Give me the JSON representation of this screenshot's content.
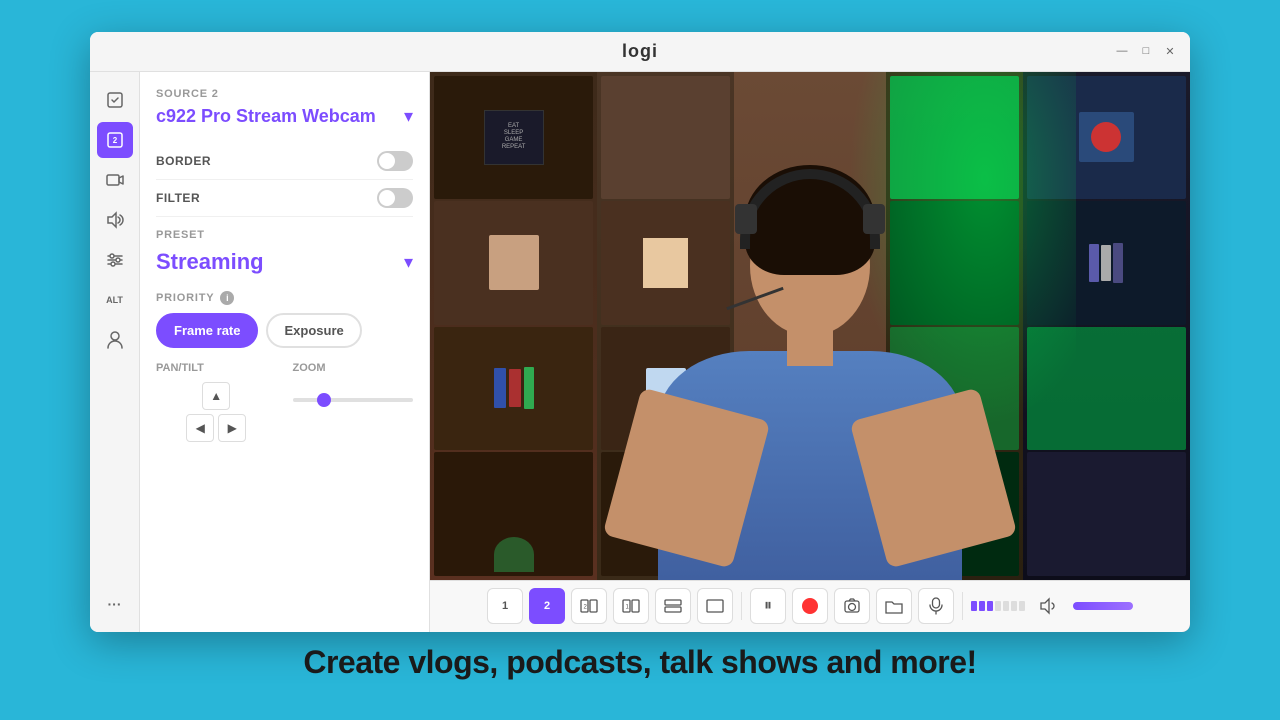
{
  "app": {
    "title": "logi",
    "window_controls": {
      "minimize": "—",
      "maximize": "□",
      "close": "✕"
    }
  },
  "sidebar": {
    "icons": [
      {
        "id": "source1",
        "symbol": "⊡",
        "active": false
      },
      {
        "id": "source2",
        "symbol": "⊡",
        "active": true
      },
      {
        "id": "camera",
        "symbol": "▭",
        "active": false
      },
      {
        "id": "audio",
        "symbol": "◁◁",
        "active": false
      },
      {
        "id": "sliders",
        "symbol": "⊞",
        "active": false
      },
      {
        "id": "alt",
        "symbol": "ALT",
        "active": false
      },
      {
        "id": "person",
        "symbol": "◯",
        "active": false
      },
      {
        "id": "more",
        "symbol": "···",
        "active": false
      }
    ]
  },
  "settings": {
    "source_label": "SOURCE 2",
    "device_name": "c922 Pro Stream Webcam",
    "border_label": "BORDER",
    "filter_label": "FILTER",
    "preset_label": "PRESET",
    "preset_value": "Streaming",
    "priority_label": "PRIORITY",
    "priority_frame_rate": "Frame rate",
    "priority_exposure": "Exposure",
    "pan_tilt_label": "PAN/TILT",
    "zoom_label": "ZOOM"
  },
  "toolbar": {
    "buttons": [
      {
        "id": "t1",
        "label": "1",
        "active": false
      },
      {
        "id": "t2",
        "label": "2",
        "active": true
      },
      {
        "id": "t3",
        "label": "⊡2",
        "active": false
      },
      {
        "id": "t4",
        "label": "⊡1",
        "active": false
      },
      {
        "id": "t5",
        "label": "⊟2",
        "active": false
      },
      {
        "id": "t6",
        "label": "⊟1",
        "active": false
      },
      {
        "id": "pause",
        "label": "⏸",
        "active": false
      },
      {
        "id": "record",
        "label": "●",
        "active": false
      },
      {
        "id": "snapshot",
        "label": "⬡",
        "active": false
      },
      {
        "id": "folder",
        "label": "⬜",
        "active": false
      },
      {
        "id": "mic",
        "label": "♪",
        "active": false
      }
    ]
  },
  "caption": {
    "text": "Create vlogs, podcasts, talk shows and more!"
  },
  "colors": {
    "accent": "#7c4dff",
    "active_bg": "#7c4dff",
    "record_red": "#ff3333",
    "background": "#29b6d8"
  }
}
